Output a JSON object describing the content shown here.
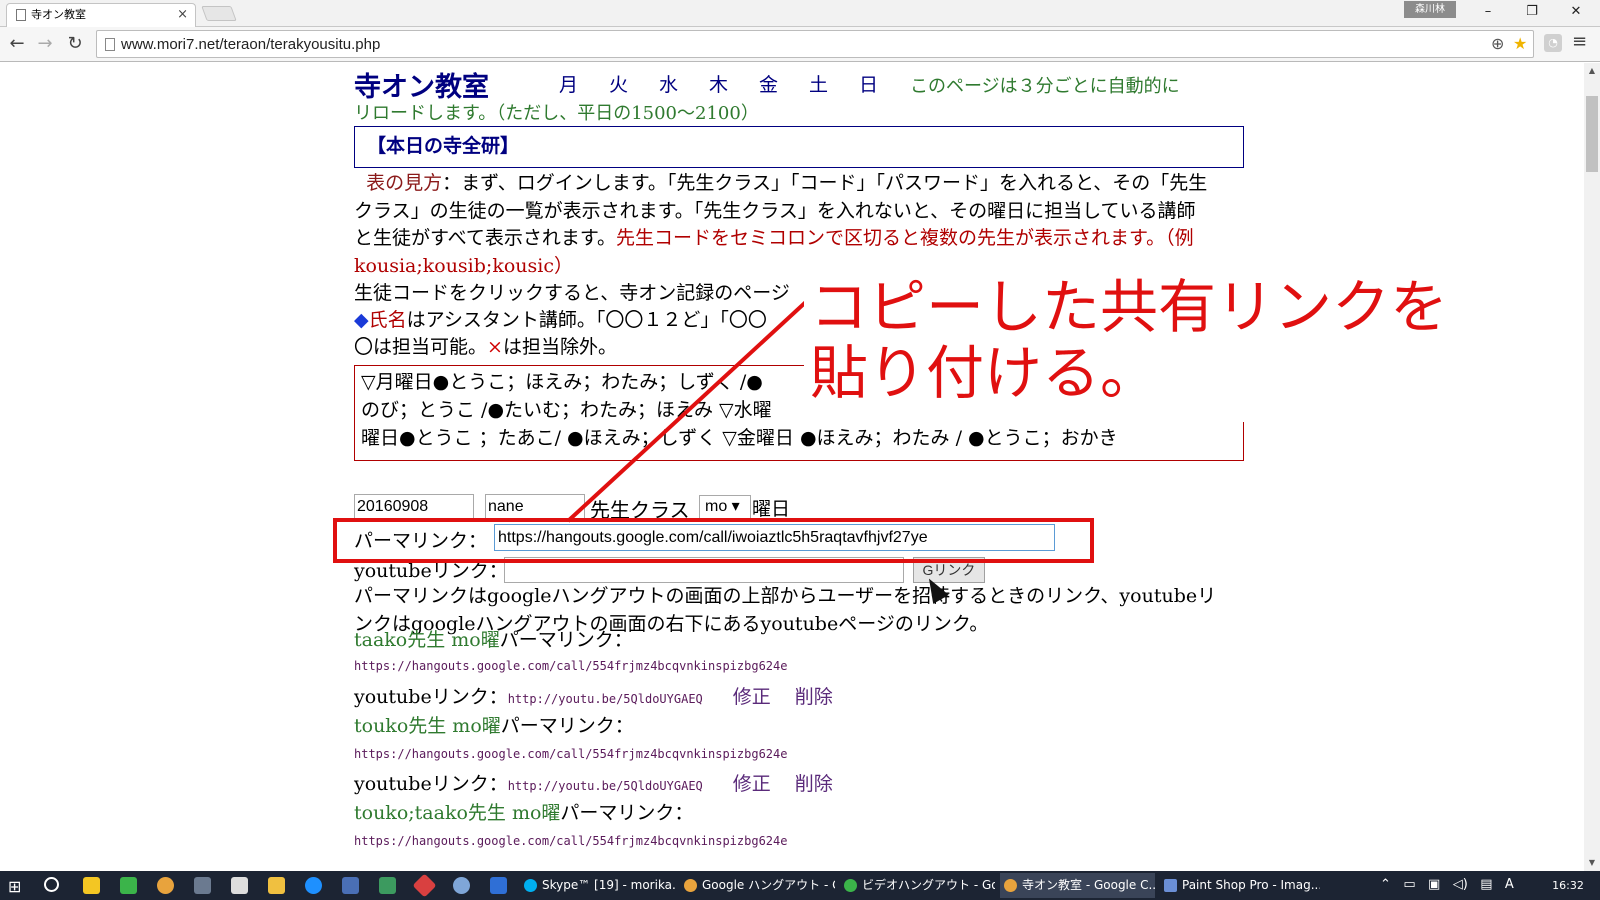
{
  "browser": {
    "tab_title": "寺オン教室",
    "user": "森川林",
    "url": "www.mori7.net/teraon/terakyousitu.php",
    "minimize": "–",
    "restore": "❐",
    "close": "✕"
  },
  "page": {
    "brand": "寺オン教室",
    "days": [
      "月",
      "火",
      "水",
      "木",
      "金",
      "土",
      "日"
    ],
    "reload_note_1": "このページは３分ごとに自動的に",
    "reload_note_2": "リロードします。（ただし、平日の1500～2100）",
    "today_box": "【本日の寺全研】",
    "legend_label": "表の見方",
    "para1_a": "：まず、ログインします。「先生クラス」「コード」「パスワード」を入れると、その「先生クラス」の生徒の一覧が表示されます。「先生クラス」を入れないと、その曜日に担当している講師と生徒がすべて表示されます。",
    "para1_b": "先生コードをセミコロンで区切ると複数の先生が表示されます。（例 kousia;kousib;kousic）",
    "para2": "生徒コードをクリックすると、寺オン記録のページ",
    "para3_mark": "◆",
    "para3_name": "氏名",
    "para3_rest": "はアシスタント講師。「〇〇１２ど」「〇〇",
    "para4_a": "〇は担当可能。",
    "para4_x": "×",
    "para4_b": "は担当除外。",
    "schedule": [
      "▽月曜日●とうこ；ほえみ；わたみ；しずく /●",
      "のび；とうこ /●たいむ；わたみ；ほえみ ▽水曜",
      "曜日●とうこ ；たあこ/ ●ほえみ；しずく ▽金曜日 ●ほえみ；わたみ / ●とうこ；おかき"
    ],
    "form": {
      "date": "20160908",
      "name": "nane",
      "class_label": "先生クラス",
      "day_value": "mo ▾",
      "day_label": "曜日",
      "permalink_label": "パーマリンク：",
      "permalink_value": "https://hangouts.google.com/call/iwoiaztlc5h5raqtavfhjvf27ye",
      "youtube_label": "youtubeリンク：",
      "glink_button": "Gリンク"
    },
    "explain": "パーマリンクはgoogleハングアウトの画面の上部からユーザーを招待するときのリンク、youtubeリンクはgoogleハングアウトの画面の右下にあるyoutubeページのリンク。",
    "entries": [
      {
        "teacher": "taako先生 mo曜",
        "perma_label": "パーマリンク：",
        "perma_url": "https://hangouts.google.com/call/554frjmz4bcqvnkinspizbg624e",
        "yt_label": "youtubeリンク：",
        "yt_url": "http://youtu.be/5QldoUYGAEQ",
        "edit": "修正",
        "delete": "削除"
      },
      {
        "teacher": "touko先生 mo曜",
        "perma_label": "パーマリンク：",
        "perma_url": "https://hangouts.google.com/call/554frjmz4bcqvnkinspizbg624e",
        "yt_label": "youtubeリンク：",
        "yt_url": "http://youtu.be/5QldoUYGAEQ",
        "edit": "修正",
        "delete": "削除"
      },
      {
        "teacher": "touko;taako先生 mo曜",
        "perma_label": "パーマリンク：",
        "perma_url": "https://hangouts.google.com/call/554frjmz4bcqvnkinspizbg624e"
      }
    ]
  },
  "annotation": {
    "line1": "コピーした共有リンクを",
    "line2": "貼り付ける。",
    "color": "#e01010"
  },
  "taskbar": {
    "tasks": [
      {
        "label": "Skype™ [19] - morika...",
        "color": "#00aff0"
      },
      {
        "label": "Google ハングアウト - G...",
        "color": "#e8a33d"
      },
      {
        "label": "ビデオハングアウト - Goo...",
        "color": "#3bb44a"
      },
      {
        "label": "寺オン教室 - Google C...",
        "color": "#e8a33d"
      },
      {
        "label": "Paint Shop Pro - Imag...",
        "color": "#6b8fd6"
      }
    ],
    "ime": "A",
    "clock": "16:32"
  }
}
